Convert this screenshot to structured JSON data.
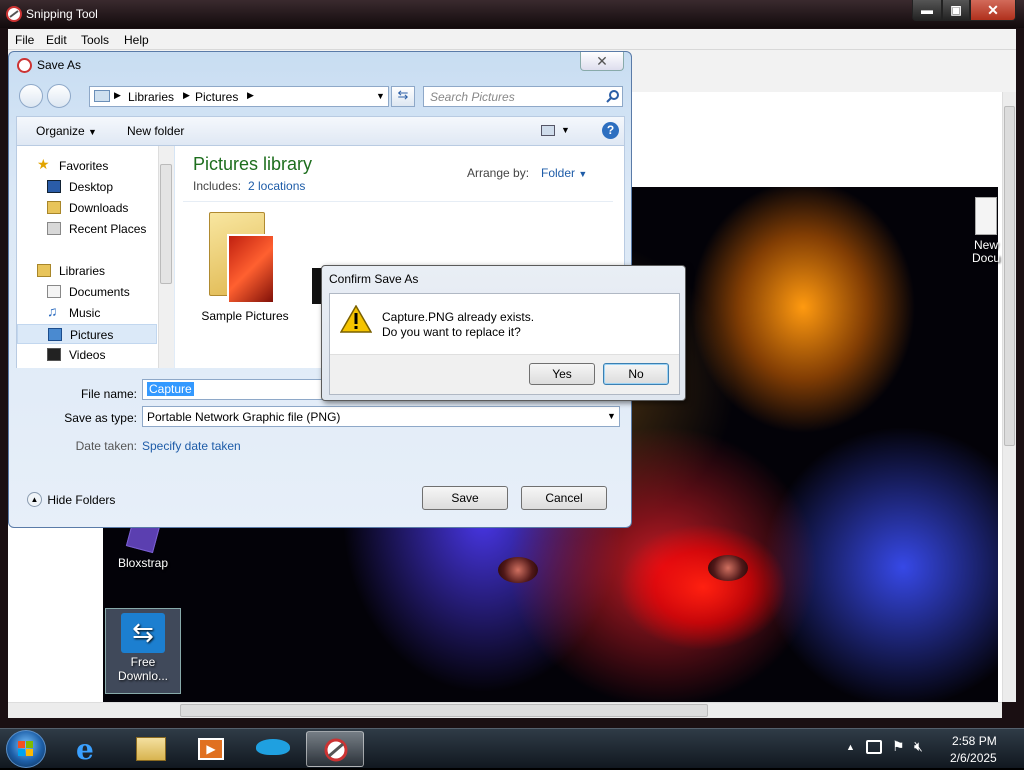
{
  "snip": {
    "title": "Snipping Tool",
    "menu": [
      "File",
      "Edit",
      "Tools",
      "Help"
    ],
    "caption_min": "▬",
    "caption_max": "▣",
    "caption_close": "✕"
  },
  "desktop": {
    "icons": [
      {
        "label": "Bloxstrap"
      },
      {
        "label": "Free\nDownlo..."
      },
      {
        "label": "New\nDocu"
      }
    ]
  },
  "saveas": {
    "title": "Save As",
    "breadcrumb": [
      "Libraries",
      "Pictures"
    ],
    "search_placeholder": "Search Pictures",
    "organize_label": "Organize",
    "new_folder_label": "New folder",
    "nav": {
      "favorites": "Favorites",
      "desktop": "Desktop",
      "downloads": "Downloads",
      "recent": "Recent Places",
      "libraries": "Libraries",
      "documents": "Documents",
      "music": "Music",
      "pictures": "Pictures",
      "videos": "Videos"
    },
    "library_title": "Pictures library",
    "includes_label": "Includes:",
    "includes_value": "2 locations",
    "arrange_label": "Arrange by:",
    "arrange_value": "Folder",
    "folder_label": "Sample Pictures",
    "file_name_label": "File name:",
    "file_name_value": "Capture",
    "save_type_label": "Save as type:",
    "save_type_value": "Portable Network Graphic file (PNG)",
    "date_taken_label": "Date taken:",
    "date_taken_value": "Specify date taken",
    "hide_folders_label": "Hide Folders",
    "save_button": "Save",
    "cancel_button": "Cancel"
  },
  "confirm": {
    "title": "Confirm Save As",
    "line1": "Capture.PNG already exists.",
    "line2": "Do you want to replace it?",
    "yes": "Yes",
    "no": "No"
  },
  "taskbar": {
    "time": "2:58 PM",
    "date": "2/6/2025"
  }
}
